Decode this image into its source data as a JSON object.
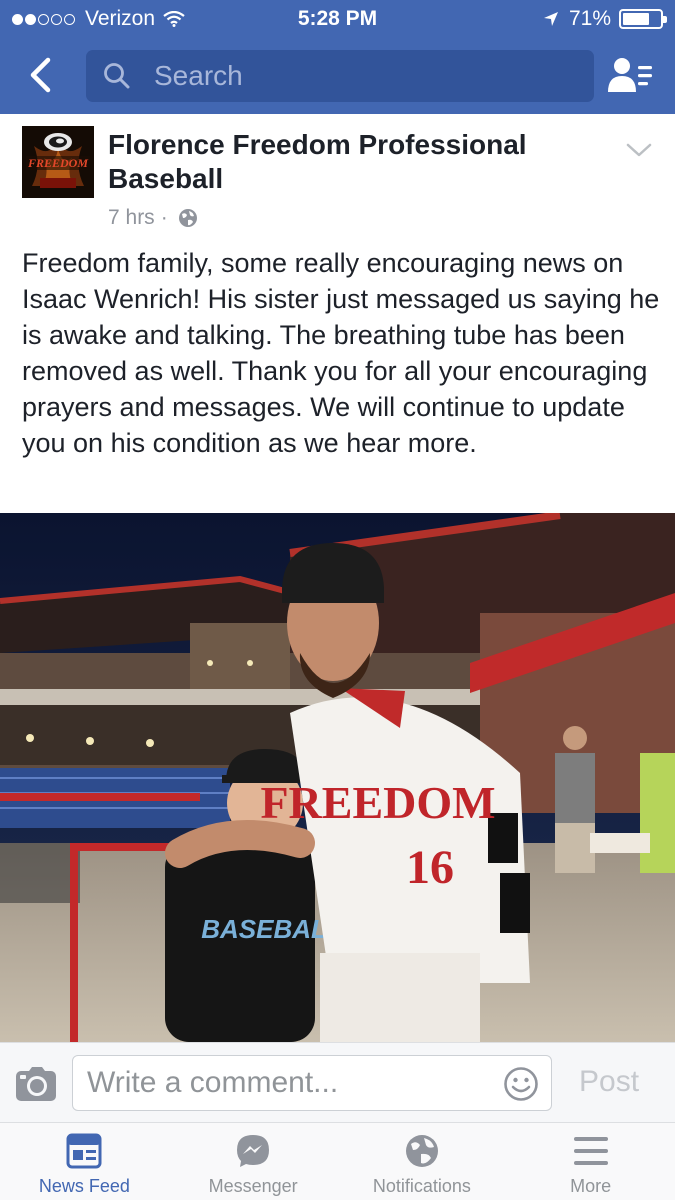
{
  "status_bar": {
    "carrier": "Verizon",
    "time": "5:28 PM",
    "battery": "71%",
    "battery_level": 0.71,
    "signal_bars": 2
  },
  "nav": {
    "search_placeholder": "Search",
    "icons": {
      "back": "back-chevron-icon",
      "search": "search-icon",
      "friends": "friend-requests-icon"
    }
  },
  "post": {
    "page_name": "Florence Freedom Professional Baseball",
    "avatar_text": "FREEDOM",
    "time": "7 hrs",
    "separator": "·",
    "audience_icon": "globe-icon",
    "text": "Freedom family, some really encouraging news on Isaac Wenrich!  His sister just messaged us saying he is awake and talking.  The breathing tube has been removed as well.  Thank you for all your encouraging prayers and messages.  We will continue to update you on his condition as we hear more.",
    "photo": {
      "jersey_text": "FREEDOM",
      "jersey_number": "16",
      "shirt_text": "BASEBALL"
    }
  },
  "comment_bar": {
    "placeholder": "Write a comment...",
    "post_label": "Post"
  },
  "tabs": [
    {
      "label": "News Feed",
      "icon": "news-feed-icon",
      "active": true
    },
    {
      "label": "Messenger",
      "icon": "messenger-icon",
      "active": false
    },
    {
      "label": "Notifications",
      "icon": "globe-icon",
      "active": false
    },
    {
      "label": "More",
      "icon": "menu-icon",
      "active": false
    }
  ],
  "colors": {
    "brand_blue": "#4267b2",
    "search_bg": "#32549a",
    "muted_text": "#90949c"
  }
}
